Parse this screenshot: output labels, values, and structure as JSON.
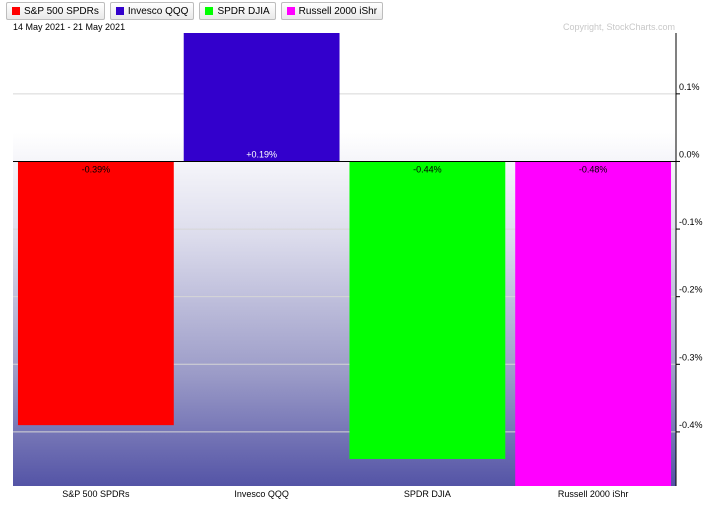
{
  "header": {
    "date_range": "14 May 2021 - 21 May 2021",
    "copyright": "Copyright, StockCharts.com"
  },
  "legend": [
    {
      "label": "S&P 500 SPDRs",
      "color": "#ff0000"
    },
    {
      "label": "Invesco QQQ",
      "color": "#3300cc"
    },
    {
      "label": "SPDR DJIA",
      "color": "#00ff00"
    },
    {
      "label": "Russell 2000 iShr",
      "color": "#ff00ff"
    }
  ],
  "chart_data": {
    "type": "bar",
    "categories": [
      "S&P 500 SPDRs",
      "Invesco QQQ",
      "SPDR DJIA",
      "Russell 2000 iShr"
    ],
    "values": [
      -0.39,
      0.19,
      -0.44,
      -0.48
    ],
    "data_labels": [
      "-0.39%",
      "+0.19%",
      "-0.44%",
      "-0.48%"
    ],
    "colors": [
      "#ff0000",
      "#3300cc",
      "#00ff00",
      "#ff00ff"
    ],
    "ylim": [
      -0.48,
      0.19
    ],
    "y_ticks": [
      0.1,
      0.0,
      -0.1,
      -0.2,
      -0.3,
      -0.4
    ],
    "y_tick_labels": [
      "0.1%",
      "0.0%",
      "-0.1%",
      "-0.2%",
      "-0.3%",
      "-0.4%"
    ],
    "axis_position": "right",
    "grid": true
  }
}
